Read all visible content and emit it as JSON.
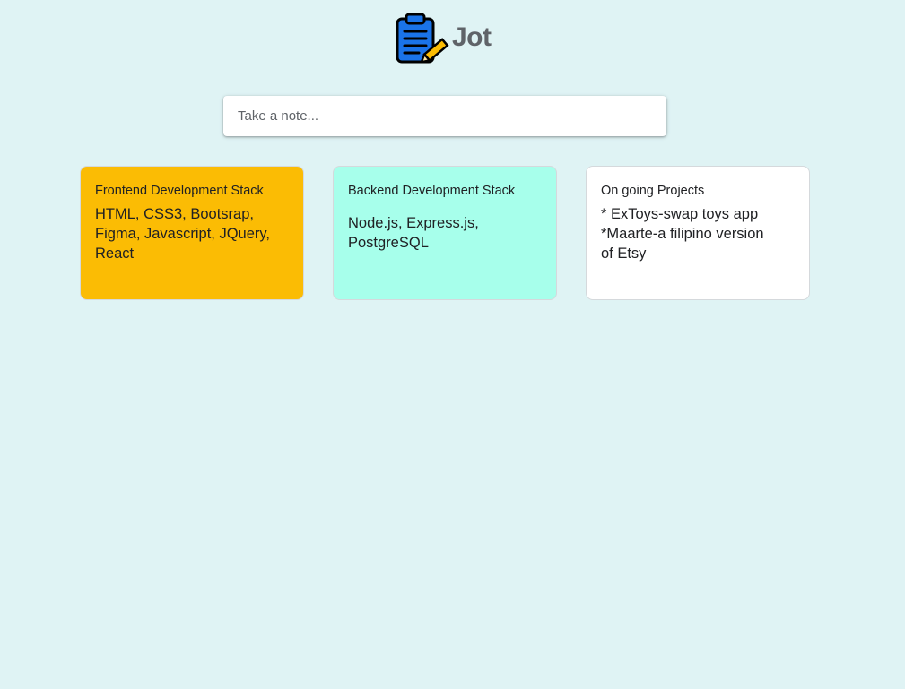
{
  "header": {
    "app_name": "Jot",
    "logo_icon": "clipboard-pencil-icon"
  },
  "composer": {
    "placeholder": "Take a note..."
  },
  "notes": [
    {
      "title": "Frontend Development Stack",
      "body": "HTML, CSS3, Bootsrap,\nFigma, Javascript, JQuery,\nReact",
      "color": "#fbbc04"
    },
    {
      "title": "Backend Development Stack",
      "body": "Node.js, Express.js,\nPostgreSQL",
      "color": "#a7ffeb"
    },
    {
      "title": "On going Projects",
      "body": "* ExToys-swap toys app\n*Maarte-a filipino version\nof Etsy",
      "color": "#ffffff"
    }
  ],
  "colors": {
    "background": "#dff3f4",
    "title_text": "#5f6368",
    "logo_blue": "#1a73e8",
    "logo_pencil": "#fbbc04"
  }
}
